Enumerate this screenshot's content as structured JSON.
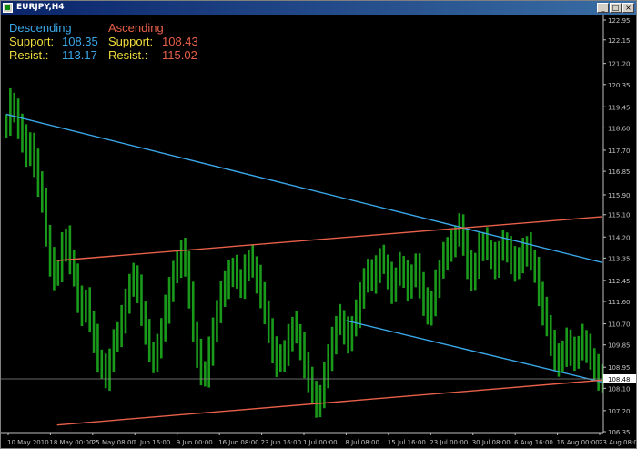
{
  "window": {
    "title": "EURJPY,H4",
    "buttons": {
      "minimize": "_",
      "maximize": "□",
      "close": "×"
    }
  },
  "legend": {
    "descending_title": "Descending",
    "ascending_title": "Ascending",
    "support_label": "Support:",
    "resist_label": "Resist.:",
    "desc_support": "108.35",
    "desc_resist": "113.17",
    "asc_support": "108.43",
    "asc_resist": "115.02"
  },
  "colors": {
    "background": "#000000",
    "candles": "#1a9a1a",
    "descending": "#3aa7e8",
    "ascending": "#e8604a",
    "label_yellow": "#f0dc3c",
    "axis": "#c0c0c0",
    "price_tag": "#ffffff"
  },
  "chart_data": {
    "type": "line",
    "title": "EURJPY,H4",
    "xlabel": "",
    "ylabel": "",
    "ylim": [
      106.35,
      122.95
    ],
    "grid": false,
    "y_ticks": [
      "122.95",
      "122.15",
      "121.20",
      "120.35",
      "119.45",
      "118.60",
      "117.70",
      "116.85",
      "115.90",
      "115.10",
      "114.20",
      "113.35",
      "112.45",
      "111.60",
      "110.70",
      "109.85",
      "108.95",
      "108.10",
      "107.20",
      "106.35"
    ],
    "x_ticks": [
      "10 May 2010",
      "18 May 00:00",
      "25 May 08:00",
      "1 Jun 16:00",
      "9 Jun 00:00",
      "16 Jun 08:00",
      "23 Jun 16:00",
      "1 Jul 00:00",
      "8 Jul 08:00",
      "15 Jul 16:00",
      "23 Jul 00:00",
      "30 Jul 08:00",
      "6 Aug 16:00",
      "16 Aug 00:00",
      "23 Aug 08:00"
    ],
    "current_price": "108.48",
    "series": [
      {
        "values": [
          118.8,
          119.6,
          119.2,
          118.7,
          118.2,
          117.5,
          117.9,
          117.2,
          116.4,
          115.6,
          114.3,
          113.2,
          112.6,
          112.9,
          113.8,
          114.1,
          113.2,
          112.6,
          111.7,
          111.2,
          111.6,
          110.8,
          110.1,
          109.3,
          108.9,
          108.6,
          109.3,
          109.9,
          110.3,
          110.9,
          111.6,
          112.2,
          112.6,
          112.1,
          111.2,
          110.3,
          109.6,
          109.3,
          109.7,
          110.5,
          111.3,
          112.1,
          112.7,
          113.1,
          113.6,
          113.2,
          111.8,
          110.4,
          109.5,
          108.8,
          108.6,
          109.6,
          110.5,
          111.1,
          111.9,
          112.3,
          112.7,
          112.9,
          112.5,
          112.3,
          112.9,
          113.3,
          113.0,
          112.5,
          111.9,
          111.1,
          110.4,
          109.7,
          109.1,
          109.3,
          109.6,
          110.1,
          110.6,
          110.3,
          109.8,
          109.1,
          108.4,
          107.9,
          107.5,
          107.7,
          108.6,
          109.4,
          110.0,
          110.6,
          110.9,
          110.4,
          110.1,
          110.6,
          111.1,
          111.9,
          112.4,
          112.8,
          112.5,
          112.9,
          113.3,
          113.1,
          112.6,
          112.1,
          112.6,
          113.0,
          112.7,
          112.2,
          112.6,
          113.0,
          112.3,
          111.6,
          111.1,
          111.6,
          112.3,
          112.9,
          113.4,
          113.8,
          113.9,
          114.2,
          114.6,
          114.0,
          113.1,
          112.5,
          113.1,
          113.8,
          114.0,
          113.7,
          113.4,
          113.1,
          113.6,
          113.9,
          113.7,
          113.3,
          112.9,
          113.3,
          113.6,
          113.8,
          113.3,
          112.8,
          112.0,
          111.2,
          110.6,
          109.9,
          109.4,
          109.1,
          109.5,
          110.0,
          109.6,
          109.3,
          109.8,
          110.1,
          109.7,
          109.3,
          108.9,
          108.6,
          108.5
        ]
      }
    ],
    "series_x_range": [
      0,
      1
    ],
    "trendlines": [
      {
        "name": "Descending resistance",
        "start": [
          0,
          119.15
        ],
        "end": [
          1,
          113.17
        ]
      },
      {
        "name": "Descending support",
        "start": [
          0.57,
          110.83
        ],
        "end": [
          1,
          108.35
        ]
      },
      {
        "name": "Ascending resistance",
        "start": [
          0.085,
          113.25
        ],
        "end": [
          1,
          115.02
        ]
      },
      {
        "name": "Ascending support",
        "start": [
          0.085,
          106.62
        ],
        "end": [
          1,
          108.43
        ]
      }
    ]
  }
}
